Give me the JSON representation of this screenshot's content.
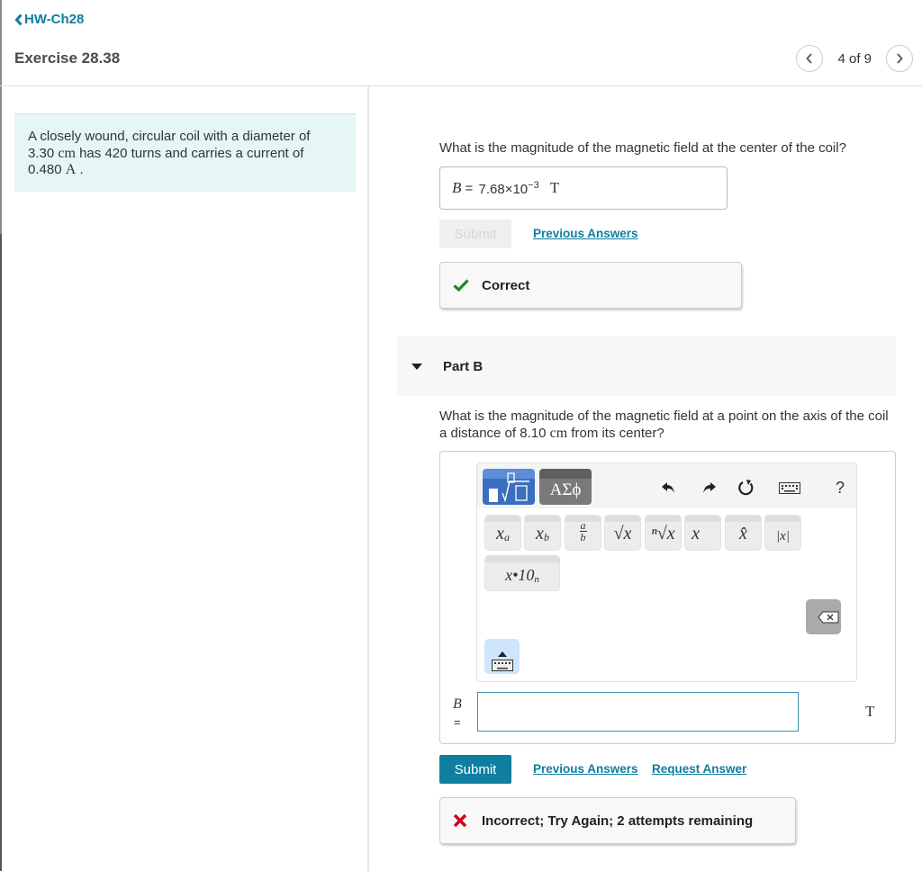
{
  "header": {
    "back_label": "HW-Ch28",
    "exercise_title": "Exercise 28.38",
    "pager": {
      "current": 4,
      "total": 9,
      "text": "4 of 9",
      "prev_icon": "chevron-left-icon",
      "next_icon": "chevron-right-icon"
    }
  },
  "problem": {
    "text_1": "A closely wound, circular coil with a diameter of",
    "text_2a": "3.30 ",
    "text_2_unit": "cm",
    "text_2b": " has 420 turns and carries a current of",
    "text_3a": "0.480 ",
    "text_3_unit": "A",
    "text_3b": " ."
  },
  "part_a": {
    "question": "What is the magnitude of the magnetic field at the center of the coil?",
    "answer_var": "B",
    "answer_eq": " = ",
    "answer_mantissa": "7.68×10",
    "answer_exponent": "−3",
    "answer_unit": "T",
    "submit_label": "Submit",
    "submit_disabled": true,
    "previous_answers_label": "Previous Answers",
    "feedback": {
      "status": "correct",
      "icon": "checkmark-icon",
      "text": "Correct",
      "color": "#1a8a2c"
    }
  },
  "part_b": {
    "header_label": "Part B",
    "question_line1a": "What is the magnitude of the magnetic field at a point on the axis of the coil",
    "question_line2a": "a distance of 8.10 ",
    "question_unit": "cm",
    "question_line2b": " from its center?",
    "toolbar": {
      "templates_tab": "templates-icon",
      "greek_tab_label": "ΑΣϕ",
      "undo_icon": "undo-icon",
      "redo_icon": "redo-icon",
      "reset_icon": "reset-icon",
      "keyboard_icon": "keyboard-icon",
      "help_label": "?"
    },
    "keys": [
      {
        "name": "superscript",
        "base": "x",
        "mod": "a"
      },
      {
        "name": "subscript",
        "base": "x",
        "mod": "b"
      },
      {
        "name": "fraction",
        "num": "a",
        "den": "b"
      },
      {
        "name": "square-root",
        "label": "√x"
      },
      {
        "name": "nth-root",
        "label": "ⁿ√x"
      },
      {
        "name": "vector",
        "label": "x⃗"
      },
      {
        "name": "unit-vector",
        "label": "x̂"
      },
      {
        "name": "absolute-value",
        "label": "|x|"
      },
      {
        "name": "scientific-notation",
        "label": "x•10",
        "mod": "n"
      }
    ],
    "input_var": "B",
    "input_eq": "=",
    "input_value": "",
    "input_unit": "T",
    "submit_label": "Submit",
    "previous_answers_label": "Previous Answers",
    "request_answer_label": "Request Answer",
    "feedback": {
      "status": "incorrect",
      "icon": "x-mark-icon",
      "text": "Incorrect; Try Again; 2 attempts remaining",
      "color": "#d0021b",
      "attempts_remaining": 2
    }
  },
  "colors": {
    "accent": "#0f7ea0",
    "problem_bg": "#e6f6f7",
    "correct": "#1a8a2c",
    "incorrect": "#d0021b"
  }
}
